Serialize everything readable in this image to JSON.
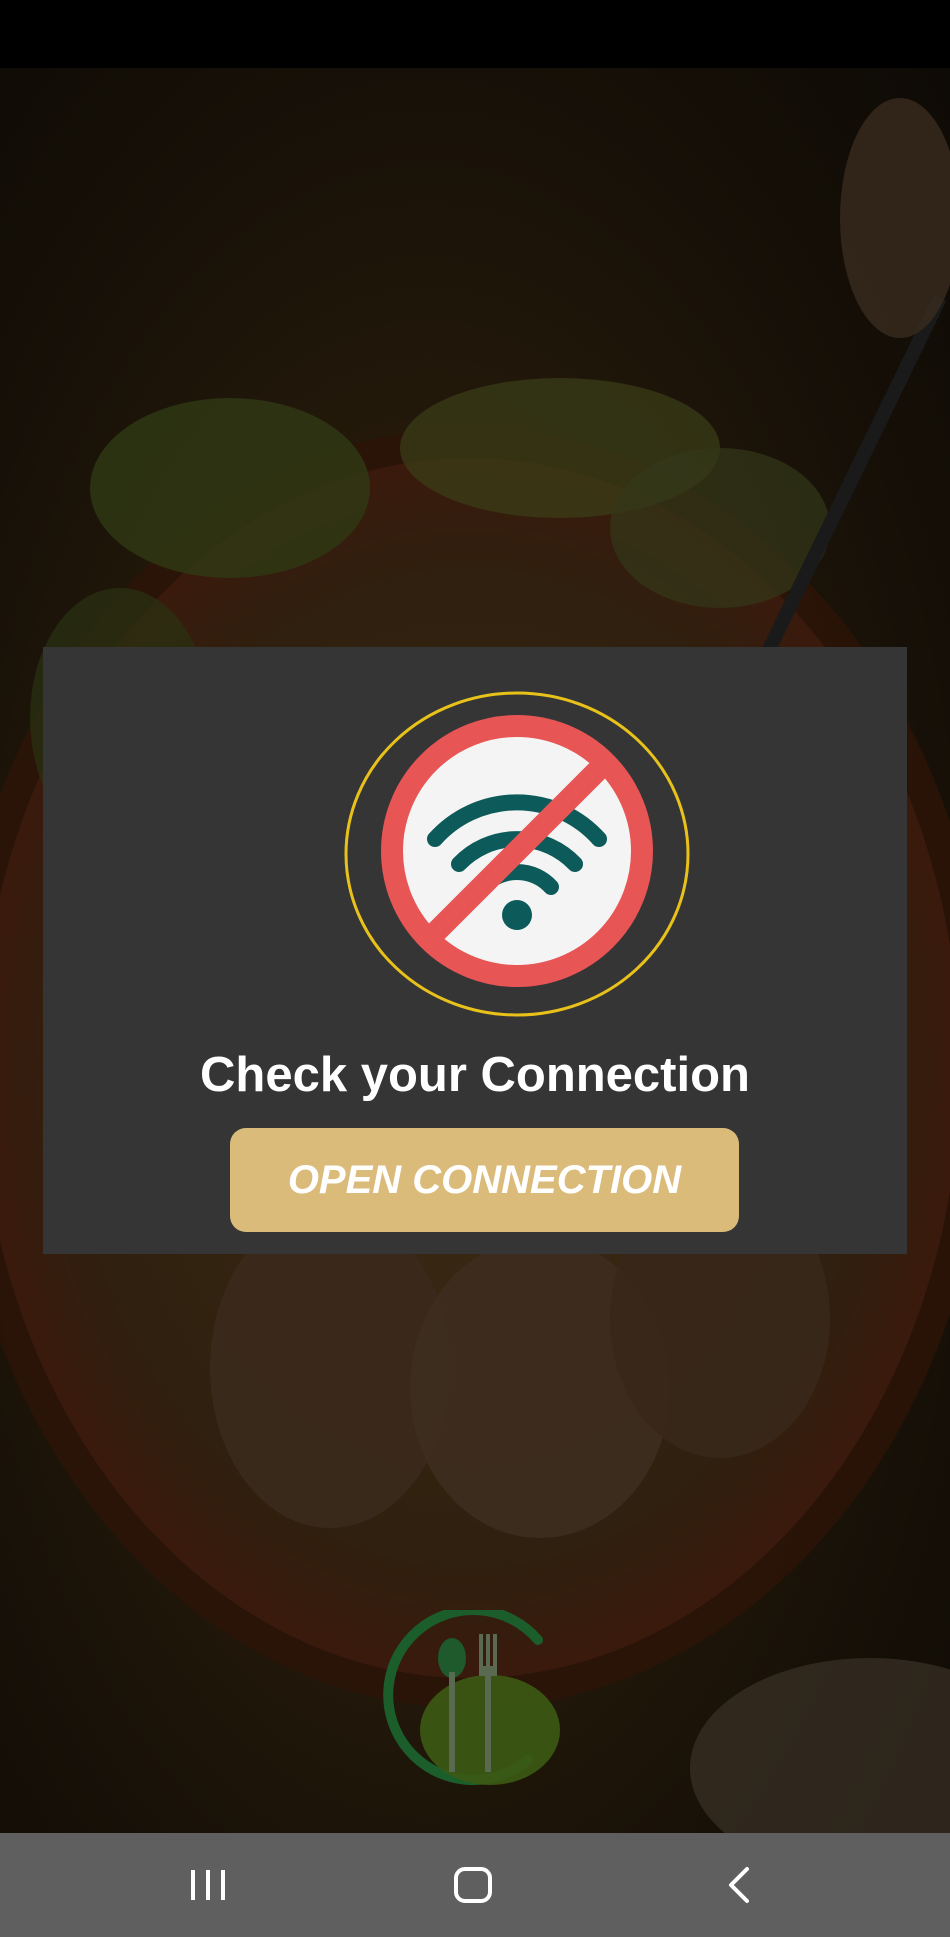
{
  "dialog": {
    "title": "Check your Connection",
    "button_label": "OPEN CONNECTION",
    "icon": "no-wifi-icon"
  },
  "colors": {
    "dialog_bg": "#353535",
    "button_bg": "#dbbb7a",
    "icon_ring": "#e8c21a",
    "icon_prohibit": "#e85555",
    "icon_wifi": "#0d5a5a",
    "logo_green": "#1b5e2b",
    "nav_bar_bg": "#5f5f5f"
  },
  "nav_bar": {
    "recent_icon": "recent-apps-icon",
    "home_icon": "home-icon",
    "back_icon": "back-icon"
  },
  "brand": {
    "logo_icon": "restaurant-logo-icon"
  }
}
